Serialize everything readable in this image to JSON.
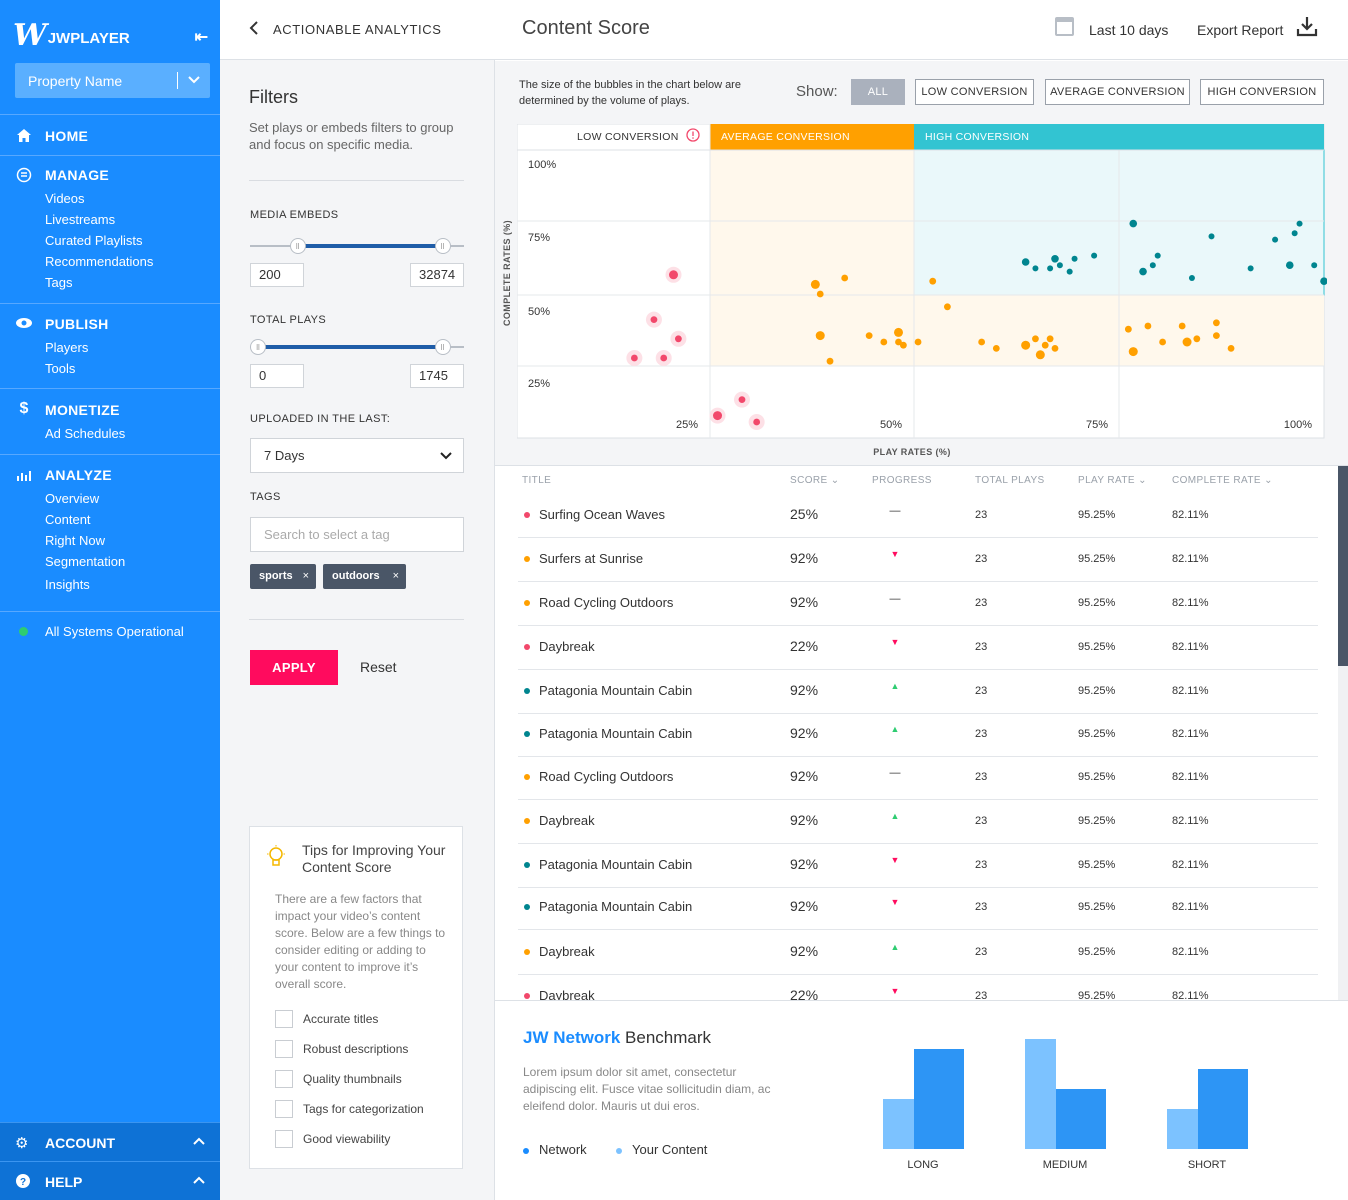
{
  "sidebar": {
    "brand": "JWPLAYER",
    "property": "Property Name",
    "sections": [
      {
        "title": "HOME",
        "icon": "home-icon",
        "items": []
      },
      {
        "title": "MANAGE",
        "icon": "manage-icon",
        "items": [
          "Videos",
          "Livestreams",
          "Curated Playlists",
          "Recommendations",
          "Tags"
        ]
      },
      {
        "title": "PUBLISH",
        "icon": "eye-icon",
        "items": [
          "Players",
          "Tools"
        ]
      },
      {
        "title": "MONETIZE",
        "icon": "dollar-icon",
        "items": [
          "Ad Schedules"
        ]
      },
      {
        "title": "ANALYZE",
        "icon": "analyze-icon",
        "items": [
          "Overview",
          "Content",
          "Right Now",
          "Segmentation",
          "Insights"
        ]
      }
    ],
    "status": "All Systems Operational",
    "footer": {
      "account": "ACCOUNT",
      "help": "HELP"
    }
  },
  "filters": {
    "back_title": "ACTIONABLE ANALYTICS",
    "title": "Filters",
    "description": "Set plays or embeds filters to group and focus on specific media.",
    "media_embeds": {
      "label": "MEDIA EMBEDS",
      "min": "200",
      "max": "32874",
      "low_frac": 0.2,
      "high_frac": 0.73
    },
    "total_plays": {
      "label": "TOTAL PLAYS",
      "min": "0",
      "max": "1745",
      "low_frac": 0.0,
      "high_frac": 0.73
    },
    "uploaded": {
      "label": "UPLOADED IN THE LAST:",
      "value": "7 Days"
    },
    "tags": {
      "label": "TAGS",
      "placeholder": "Search to select a tag",
      "chips": [
        "sports",
        "outdoors"
      ]
    },
    "apply": "APPLY",
    "reset": "Reset",
    "tips": {
      "title": "Tips for Improving Your Content Score",
      "body": "There are a few factors that impact your video’s content score. Below are a few things to consider editing or adding to your content to improve it’s overall score.",
      "checks": [
        "Accurate titles",
        "Robust descriptions",
        "Quality thumbnails",
        "Tags for categorization",
        "Good viewability"
      ]
    }
  },
  "header": {
    "title": "Content Score",
    "range": "Last 10 days",
    "export": "Export Report"
  },
  "chart_controls": {
    "note": "The size of the bubbles in the chart below are determined by the volume of plays.",
    "show_label": "Show:",
    "buttons": [
      "ALL",
      "LOW CONVERSION",
      "AVERAGE CONVERSION",
      "HIGH CONVERSION"
    ]
  },
  "colors": {
    "low": "#f2486b",
    "average": "#ffa000",
    "high": "#00858f",
    "high_header": "#32c4d2",
    "brand": "#1a8cff"
  },
  "chart_data": [
    {
      "type": "scatter",
      "bands": [
        "LOW CONVERSION",
        "AVERAGE CONVERSION",
        "HIGH CONVERSION"
      ],
      "xlabel": "PLAY RATES (%)",
      "ylabel": "COMPLETE RATES (%)",
      "x_ticks": [
        "25%",
        "50%",
        "75%",
        "100%"
      ],
      "y_ticks": [
        "100%",
        "75%",
        "50%",
        "25%"
      ],
      "xlim": [
        0,
        100
      ],
      "ylim": [
        15,
        105
      ],
      "series": [
        {
          "name": "LOW CONVERSION",
          "points": [
            [
              32,
              66
            ],
            [
              28,
              52
            ],
            [
              33,
              46
            ],
            [
              24,
              40
            ],
            [
              30,
              40
            ],
            [
              41,
              22
            ],
            [
              49,
              20
            ],
            [
              46,
              27
            ]
          ]
        },
        {
          "name": "AVERAGE CONVERSION",
          "points": [
            [
              61,
              63
            ],
            [
              62,
              60
            ],
            [
              67,
              65
            ],
            [
              85,
              64
            ],
            [
              88,
              56
            ],
            [
              62,
              47
            ],
            [
              64,
              39
            ],
            [
              72,
              47
            ],
            [
              75,
              45
            ],
            [
              78,
              45
            ],
            [
              78,
              48
            ],
            [
              79,
              44
            ],
            [
              82,
              45
            ],
            [
              95,
              45
            ],
            [
              98,
              43
            ],
            [
              104,
              44
            ],
            [
              106,
              46
            ],
            [
              108,
              44
            ],
            [
              109,
              46
            ],
            [
              110,
              43
            ],
            [
              107,
              41
            ],
            [
              125,
              49
            ],
            [
              129,
              50
            ],
            [
              132,
              45
            ],
            [
              136,
              50
            ],
            [
              137,
              45
            ],
            [
              139,
              46
            ],
            [
              143,
              51
            ],
            [
              143,
              47
            ],
            [
              146,
              43
            ],
            [
              126,
              42
            ]
          ]
        },
        {
          "name": "HIGH CONVERSION",
          "points": [
            [
              104,
              70
            ],
            [
              109,
              68
            ],
            [
              113,
              67
            ],
            [
              106,
              68
            ],
            [
              110,
              71
            ],
            [
              111,
              69
            ],
            [
              114,
              71
            ],
            [
              118,
              72
            ],
            [
              126,
              82
            ],
            [
              130,
              69
            ],
            [
              131,
              72
            ],
            [
              142,
              78
            ],
            [
              128,
              67
            ],
            [
              138,
              65
            ],
            [
              150,
              68
            ],
            [
              155,
              77
            ],
            [
              158,
              69
            ],
            [
              159,
              79
            ],
            [
              160,
              82
            ],
            [
              163,
              69
            ],
            [
              165,
              64
            ]
          ]
        }
      ]
    },
    {
      "type": "bar",
      "title": "JW Network Benchmark",
      "categories": [
        "LONG",
        "MEDIUM",
        "SHORT"
      ],
      "series": [
        {
          "name": "Network",
          "values": [
            50,
            110,
            40
          ]
        },
        {
          "name": "Your Content",
          "values": [
            100,
            60,
            80
          ]
        }
      ],
      "ylim": [
        0,
        110
      ]
    }
  ],
  "table": {
    "headers": [
      "TITLE",
      "SCORE",
      "PROGRESS",
      "TOTAL PLAYS",
      "PLAY RATE",
      "COMPLETE RATE"
    ],
    "rows": [
      {
        "title": "Surfing Ocean Waves",
        "score": "25%",
        "progress": "flat",
        "plays": "23",
        "play_rate": "95.25%",
        "complete_rate": "82.11%",
        "group": "low"
      },
      {
        "title": "Surfers at Sunrise",
        "score": "92%",
        "progress": "down",
        "plays": "23",
        "play_rate": "95.25%",
        "complete_rate": "82.11%",
        "group": "average"
      },
      {
        "title": "Road Cycling Outdoors",
        "score": "92%",
        "progress": "flat",
        "plays": "23",
        "play_rate": "95.25%",
        "complete_rate": "82.11%",
        "group": "average"
      },
      {
        "title": "Daybreak",
        "score": "22%",
        "progress": "down",
        "plays": "23",
        "play_rate": "95.25%",
        "complete_rate": "82.11%",
        "group": "low"
      },
      {
        "title": "Patagonia Mountain Cabin",
        "score": "92%",
        "progress": "up",
        "plays": "23",
        "play_rate": "95.25%",
        "complete_rate": "82.11%",
        "group": "high"
      },
      {
        "title": "Patagonia Mountain Cabin",
        "score": "92%",
        "progress": "up",
        "plays": "23",
        "play_rate": "95.25%",
        "complete_rate": "82.11%",
        "group": "high"
      },
      {
        "title": "Road Cycling Outdoors",
        "score": "92%",
        "progress": "flat",
        "plays": "23",
        "play_rate": "95.25%",
        "complete_rate": "82.11%",
        "group": "average"
      },
      {
        "title": "Daybreak",
        "score": "92%",
        "progress": "up",
        "plays": "23",
        "play_rate": "95.25%",
        "complete_rate": "82.11%",
        "group": "average"
      },
      {
        "title": "Patagonia Mountain Cabin",
        "score": "92%",
        "progress": "down",
        "plays": "23",
        "play_rate": "95.25%",
        "complete_rate": "82.11%",
        "group": "high"
      },
      {
        "title": "Patagonia Mountain Cabin",
        "score": "92%",
        "progress": "down",
        "plays": "23",
        "play_rate": "95.25%",
        "complete_rate": "82.11%",
        "group": "high"
      },
      {
        "title": "Daybreak",
        "score": "92%",
        "progress": "up",
        "plays": "23",
        "play_rate": "95.25%",
        "complete_rate": "82.11%",
        "group": "average"
      },
      {
        "title": "Daybreak",
        "score": "22%",
        "progress": "down",
        "plays": "23",
        "play_rate": "95.25%",
        "complete_rate": "82.11%",
        "group": "low"
      }
    ]
  },
  "benchmark": {
    "title_bold": "JW Network",
    "title_rest": "Benchmark",
    "description": "Lorem ipsum dolor sit amet, consectetur adipiscing elit. Fusce vitae sollicitudin diam, ac eleifend dolor. Mauris ut dui eros.",
    "legend": [
      "Network",
      "Your Content"
    ]
  }
}
